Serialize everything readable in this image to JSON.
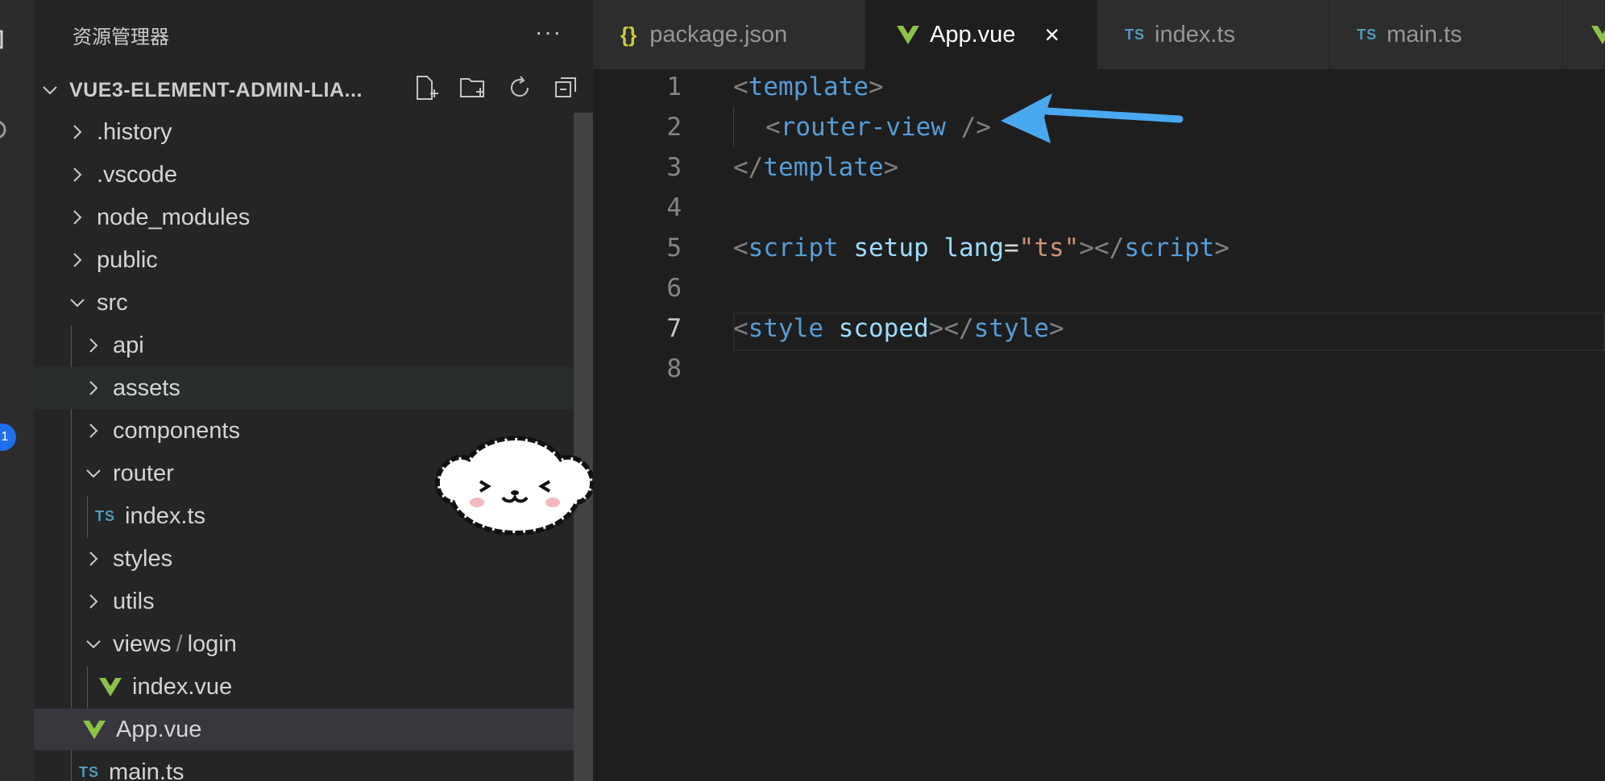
{
  "activity_bar": {
    "badge_count": "1"
  },
  "explorer": {
    "title": "资源管理器",
    "more": "···",
    "root_label": "VUE3-ELEMENT-ADMIN-LIA...",
    "items": [
      {
        "label": ".history"
      },
      {
        "label": ".vscode"
      },
      {
        "label": "node_modules"
      },
      {
        "label": "public"
      },
      {
        "label": "src"
      },
      {
        "label": "api"
      },
      {
        "label": "assets"
      },
      {
        "label": "components"
      },
      {
        "label": "router"
      },
      {
        "label": "index.ts",
        "icon": "TS"
      },
      {
        "label": "styles"
      },
      {
        "label": "utils"
      },
      {
        "label": "views",
        "label2": "login"
      },
      {
        "label": "index.vue"
      },
      {
        "label": "App.vue"
      },
      {
        "label": "main.ts",
        "icon": "TS"
      }
    ]
  },
  "tabs": [
    {
      "label": "package.json",
      "icon": "{}"
    },
    {
      "label": "App.vue",
      "close": "×"
    },
    {
      "label": "index.ts",
      "icon": "TS"
    },
    {
      "label": "main.ts",
      "icon": "TS"
    }
  ],
  "editor": {
    "line_numbers": [
      "1",
      "2",
      "3",
      "4",
      "5",
      "6",
      "7",
      "8"
    ],
    "lines": {
      "l1": {
        "open": "<",
        "tag": "template",
        "close": ">"
      },
      "l2": {
        "open": "<",
        "tag": "router-view",
        "close": " />"
      },
      "l3": {
        "open": "</",
        "tag": "template",
        "close": ">"
      },
      "l5": {
        "open": "<",
        "tag": "script",
        "attr1": "setup",
        "attr2": "lang",
        "eq": "=",
        "str": "\"ts\"",
        "close1": "></",
        "tag2": "script",
        "close2": ">"
      },
      "l7": {
        "open": "<",
        "tag": "style",
        "attr1": "scoped",
        "close1": "></",
        "tag2": "style",
        "close2": ">"
      }
    }
  },
  "colors": {
    "vue_green": "#8dc149",
    "ts_blue": "#519aba",
    "arrow_blue": "#4aa8ef",
    "tag_blue": "#569cd6",
    "attr_blue": "#9cdcfe",
    "string_orange": "#ce9178"
  }
}
